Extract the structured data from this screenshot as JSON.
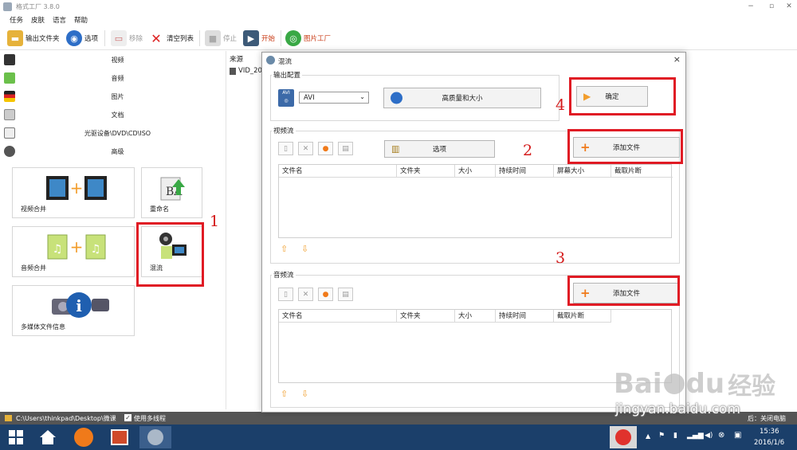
{
  "window": {
    "title": "格式工厂 3.8.0"
  },
  "menu": [
    "任务",
    "皮肤",
    "语言",
    "帮助"
  ],
  "toolbar": {
    "output_folder": "输出文件夹",
    "options": "选项",
    "remove": "移除",
    "clear_list": "清空列表",
    "stop": "停止",
    "start": "开始",
    "picture_factory": "图片工厂"
  },
  "categories": [
    "视频",
    "音频",
    "图片",
    "文档",
    "光驱设备\\DVD\\CD\\ISO",
    "高级"
  ],
  "tiles": {
    "video_merge": "视频合并",
    "rename": "重命名",
    "audio_merge": "音频合并",
    "mux": "混流",
    "media_info": "多媒体文件信息"
  },
  "source": {
    "header": "来源",
    "file": "VID_20"
  },
  "status": {
    "path": "C:\\Users\\thinkpad\\Desktop\\微课",
    "multithread": "使用多线程",
    "shutdown": "后：关闭电脑"
  },
  "taskbar": {
    "time": "15:36",
    "date": "2016/1/6"
  },
  "dialog": {
    "title": "混流",
    "output_group": "输出配置",
    "format": "AVI",
    "quality": "高质量和大小",
    "ok": "确定",
    "video_group": "视频流",
    "video_options": "选项",
    "add_file_video": "添加文件",
    "video_columns": [
      "文件名",
      "文件夹",
      "大小",
      "持续时间",
      "屏幕大小",
      "截取片断"
    ],
    "audio_group": "音频流",
    "add_file_audio": "添加文件",
    "audio_columns": [
      "文件名",
      "文件夹",
      "大小",
      "持续时间",
      "截取片断"
    ]
  },
  "annotations": [
    "1",
    "2",
    "3",
    "4"
  ],
  "watermark": {
    "brand": "Bai",
    "brand2": "du",
    "cn": "经验",
    "url": "jingyan.baidu.com"
  }
}
